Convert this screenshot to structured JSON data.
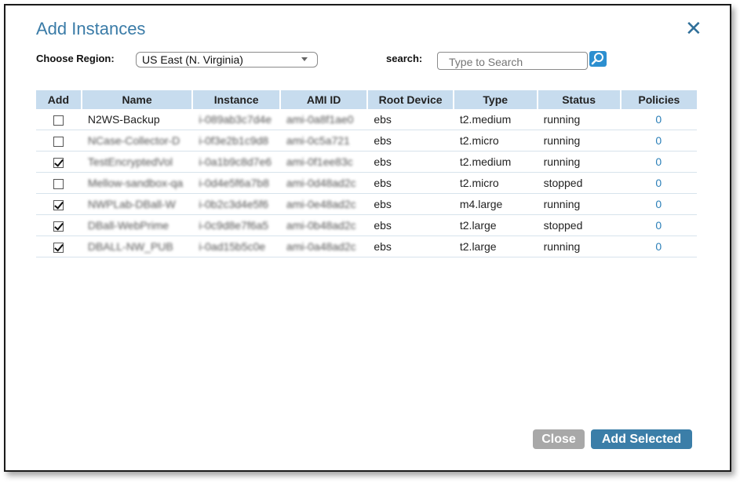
{
  "dialog": {
    "title": "Add Instances",
    "close_icon": "close-x-icon"
  },
  "region": {
    "label": "Choose Region:",
    "selected": "US East (N. Virginia)"
  },
  "search": {
    "label": "search:",
    "placeholder": "Type to Search",
    "icon": "search-icon"
  },
  "table": {
    "columns": [
      "Add",
      "Name",
      "Instance",
      "AMI ID",
      "Root Device",
      "Type",
      "Status",
      "Policies"
    ],
    "rows": [
      {
        "checked": false,
        "name": "N2WS-Backup",
        "instance": "i-089ab3c7d4e",
        "ami": "ami-0a8f1ae0",
        "root": "ebs",
        "type": "t2.medium",
        "status": "running",
        "policies": "0"
      },
      {
        "checked": false,
        "name": "NCase-Collector-D",
        "instance": "i-0f3e2b1c9d8",
        "ami": "ami-0c5a721",
        "root": "ebs",
        "type": "t2.micro",
        "status": "running",
        "policies": "0"
      },
      {
        "checked": true,
        "name": "TestEncryptedVol",
        "instance": "i-0a1b9c8d7e6",
        "ami": "ami-0f1ee83c",
        "root": "ebs",
        "type": "t2.medium",
        "status": "running",
        "policies": "0"
      },
      {
        "checked": false,
        "name": "Mellow-sandbox-qa",
        "instance": "i-0d4e5f6a7b8",
        "ami": "ami-0d48ad2c",
        "root": "ebs",
        "type": "t2.micro",
        "status": "stopped",
        "policies": "0"
      },
      {
        "checked": true,
        "name": "NWPLab-DBall-W",
        "instance": "i-0b2c3d4e5f6",
        "ami": "ami-0e48ad2c",
        "root": "ebs",
        "type": "m4.large",
        "status": "running",
        "policies": "0"
      },
      {
        "checked": true,
        "name": "DBall-WebPrime",
        "instance": "i-0c9d8e7f6a5",
        "ami": "ami-0b48ad2c",
        "root": "ebs",
        "type": "t2.large",
        "status": "stopped",
        "policies": "0"
      },
      {
        "checked": true,
        "name": "DBALL-NW_PUB",
        "instance": "i-0ad15b5c0e",
        "ami": "ami-0a48ad2c",
        "root": "ebs",
        "type": "t2.large",
        "status": "running",
        "policies": "0"
      }
    ]
  },
  "buttons": {
    "close": "Close",
    "add_selected": "Add Selected"
  },
  "colors": {
    "title": "#3a7ba7",
    "header_bg": "#c7dcee",
    "primary_button": "#3b7ea8",
    "secondary_button": "#a8a8a8",
    "link": "#2b7fb8"
  }
}
